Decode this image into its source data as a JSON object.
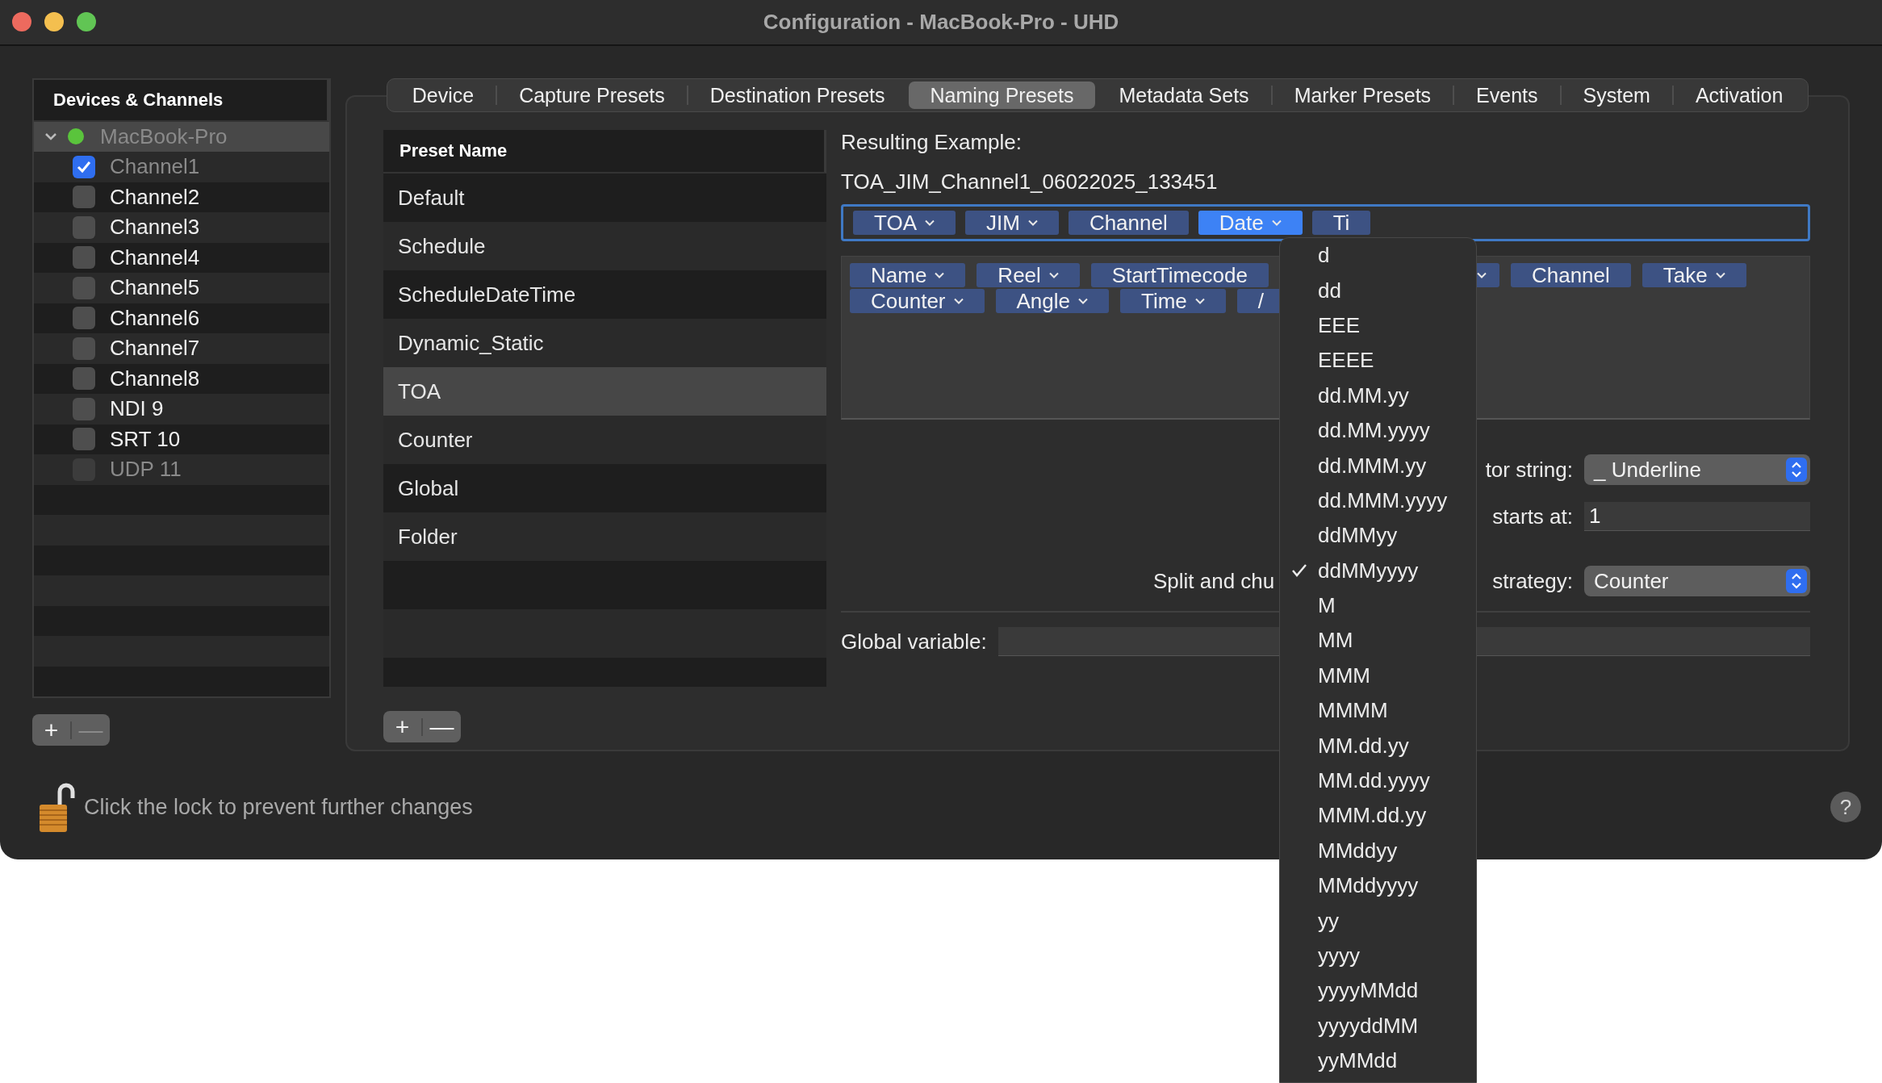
{
  "window": {
    "title": "Configuration - MacBook-Pro - UHD"
  },
  "sidebar": {
    "title": "Devices & Channels",
    "devices": [
      {
        "name": "MacBook-Pro",
        "expanded": true,
        "selected": true,
        "color": "#5ac43c",
        "children": [
          {
            "label": "Channel1",
            "checked": true,
            "disabled": true
          },
          {
            "label": "Channel2",
            "checked": false,
            "disabled": false
          },
          {
            "label": "Channel3",
            "checked": false,
            "disabled": false
          },
          {
            "label": "Channel4",
            "checked": false,
            "disabled": false
          },
          {
            "label": "Channel5",
            "checked": false,
            "disabled": false
          },
          {
            "label": "Channel6",
            "checked": false,
            "disabled": false
          },
          {
            "label": "Channel7",
            "checked": false,
            "disabled": false
          },
          {
            "label": "Channel8",
            "checked": false,
            "disabled": false
          },
          {
            "label": "NDI 9",
            "checked": false,
            "disabled": false
          },
          {
            "label": "SRT 10",
            "checked": false,
            "disabled": false
          },
          {
            "label": "UDP 11",
            "checked": false,
            "disabled": true
          }
        ]
      }
    ],
    "add_button": {
      "label": "+",
      "disabled": false
    },
    "remove_button": {
      "label": "—",
      "disabled": true
    }
  },
  "tabs": [
    {
      "label": "Device",
      "selected": false
    },
    {
      "label": "Capture Presets",
      "selected": false
    },
    {
      "label": "Destination Presets",
      "selected": false
    },
    {
      "label": "Naming Presets",
      "selected": true
    },
    {
      "label": "Metadata Sets",
      "selected": false
    },
    {
      "label": "Marker Presets",
      "selected": false
    },
    {
      "label": "Events",
      "selected": false
    },
    {
      "label": "System",
      "selected": false
    },
    {
      "label": "Activation",
      "selected": false
    }
  ],
  "presets": {
    "column": "Preset Name",
    "rows": [
      {
        "name": "Default",
        "selected": false
      },
      {
        "name": "Schedule",
        "selected": false
      },
      {
        "name": "ScheduleDateTime",
        "selected": false
      },
      {
        "name": "Dynamic_Static",
        "selected": false
      },
      {
        "name": "TOA",
        "selected": true
      },
      {
        "name": "Counter",
        "selected": false
      },
      {
        "name": "Global",
        "selected": false
      },
      {
        "name": "Folder",
        "selected": false
      }
    ],
    "add_button": {
      "label": "+",
      "disabled": false
    },
    "remove_button": {
      "label": "—",
      "disabled": false
    }
  },
  "naming": {
    "example_label": "Resulting Example:",
    "example": "TOA_JIM_Channel1_06022025_133451",
    "pattern": [
      {
        "label": "TOA",
        "menu": true,
        "selected": false
      },
      {
        "label": "JIM",
        "menu": true,
        "selected": false
      },
      {
        "label": "Channel",
        "menu": false,
        "selected": false
      },
      {
        "label": "Date",
        "menu": true,
        "selected": true
      },
      {
        "label": "Ti",
        "menu": false,
        "selected": false
      }
    ],
    "pool": [
      [
        {
          "label": "Name",
          "menu": true
        },
        {
          "label": "Reel",
          "menu": true
        },
        {
          "label": "StartTimecode",
          "menu": false
        },
        {
          "menu": true
        },
        {
          "label": "Channel",
          "menu": false
        },
        {
          "label": "Take",
          "menu": true
        }
      ],
      [
        {
          "label": "Counter",
          "menu": true
        },
        {
          "label": "Angle",
          "menu": true
        },
        {
          "label": "Time",
          "menu": true
        },
        {
          "label": "/",
          "menu": false
        }
      ]
    ],
    "form": [
      {
        "kind": "popup",
        "label_right": "tor string:",
        "value": "_ Underline"
      },
      {
        "kind": "field",
        "label_right": "starts at:",
        "value": "1"
      },
      {
        "kind": "popup",
        "label_left": "Split and chu",
        "label_right": "strategy:",
        "value": "Counter"
      }
    ],
    "global_label": "Global variable:"
  },
  "date_menu": [
    {
      "label": "d",
      "selected": false
    },
    {
      "label": "dd",
      "selected": false
    },
    {
      "label": "EEE",
      "selected": false
    },
    {
      "label": "EEEE",
      "selected": false
    },
    {
      "label": "dd.MM.yy",
      "selected": false
    },
    {
      "label": "dd.MM.yyyy",
      "selected": false
    },
    {
      "label": "dd.MMM.yy",
      "selected": false
    },
    {
      "label": "dd.MMM.yyyy",
      "selected": false
    },
    {
      "label": "ddMMyy",
      "selected": false
    },
    {
      "label": "ddMMyyyy",
      "selected": true
    },
    {
      "label": "M",
      "selected": false
    },
    {
      "label": "MM",
      "selected": false
    },
    {
      "label": "MMM",
      "selected": false
    },
    {
      "label": "MMMM",
      "selected": false
    },
    {
      "label": "MM.dd.yy",
      "selected": false
    },
    {
      "label": "MM.dd.yyyy",
      "selected": false
    },
    {
      "label": "MMM.dd.yy",
      "selected": false
    },
    {
      "label": "MMddyy",
      "selected": false
    },
    {
      "label": "MMddyyyy",
      "selected": false
    },
    {
      "label": "yy",
      "selected": false
    },
    {
      "label": "yyyy",
      "selected": false
    },
    {
      "label": "yyyyMMdd",
      "selected": false
    },
    {
      "label": "yyyyddMM",
      "selected": false
    },
    {
      "label": "yyMMdd",
      "selected": false
    }
  ],
  "lock": {
    "text": "Click the lock to prevent further changes",
    "locked": false
  },
  "help": {
    "label": "?"
  }
}
